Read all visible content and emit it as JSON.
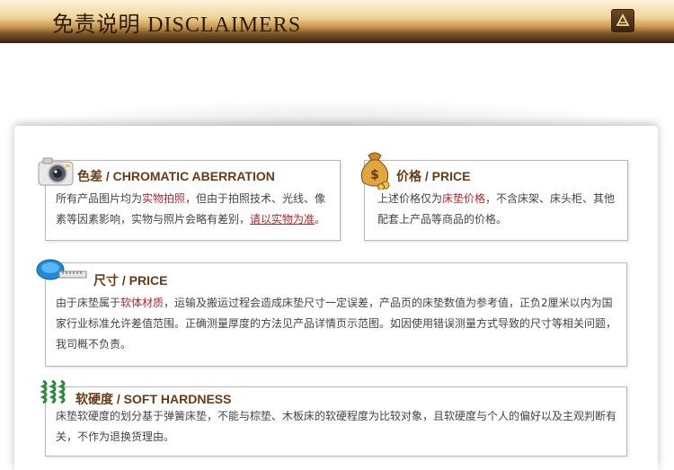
{
  "header": {
    "title_cn": "免责说明",
    "title_en": "DISCLAIMERS"
  },
  "sections": {
    "color": {
      "title": "色差 / CHROMATIC ABERRATION",
      "text_a": "所有产品图片均为",
      "hl_a": "实物拍照",
      "text_b": "，但由于拍照技术、光线、像素等因素影响，实物与照片会略有差别，",
      "hl_b": "请以实物为准",
      "text_c": "。"
    },
    "price": {
      "title": "价格 / PRICE",
      "text_a": "上述价格仅为",
      "hl_a": "床垫价格",
      "text_b": "，不含床架、床头柜、其他配套上产品等商品的价格。"
    },
    "size": {
      "title": "尺寸 / PRICE",
      "text_a": "由于床垫属于",
      "hl_a": "软体材质",
      "text_b": "，运输及搬运过程会造成床垫尺寸一定误差，产品页的床垫数值为参考值，正负2厘米以内为国家行业标准允许差值范围。正确测量厚度的方法见产品详情页示范图。如因使用错误测量方式导致的尺寸等相关问题，我司概不负责。"
    },
    "hardness": {
      "title": "软硬度 / SOFT HARDNESS",
      "text": "床垫软硬度的划分基于弹簧床垫，不能与棕垫、木板床的软硬程度为比较对象，且软硬度与个人的偏好以及主观判断有关，不作为退换货理由。"
    }
  },
  "colors": {
    "accent": "#b3272a",
    "title": "#6b3a14"
  }
}
